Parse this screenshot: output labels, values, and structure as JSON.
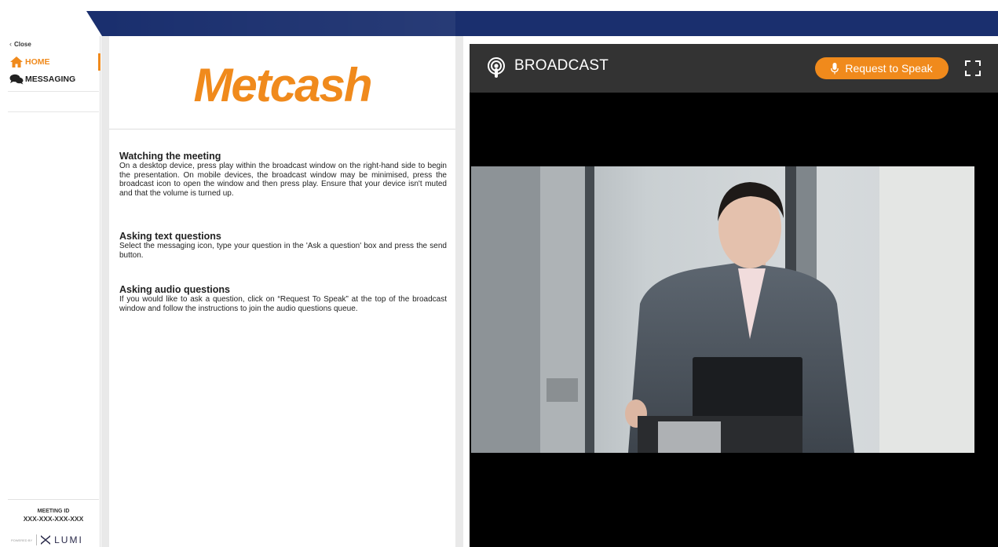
{
  "sidebar": {
    "close_label": "Close",
    "items": [
      {
        "label": "HOME",
        "icon": "home-icon",
        "active": true
      },
      {
        "label": "MESSAGING",
        "icon": "chat-bubbles-icon",
        "active": false
      }
    ],
    "meeting_id_label": "MEETING ID",
    "meeting_id_value": "XXX-XXX-XXX-XXX",
    "powered_by": "POWERED BY",
    "lumi": "LUMI"
  },
  "logo": {
    "text": "Metcash"
  },
  "sections": [
    {
      "heading": "Watching the meeting",
      "body": "On a desktop device, press play within the broadcast window on the right-hand side to begin the presentation. On mobile devices, the broadcast window may be minimised, press the broadcast icon to open the window and then press play. Ensure that your device isn't muted and that the volume is turned up."
    },
    {
      "heading": "Asking text questions",
      "body": "Select the messaging icon, type your question in the 'Ask a question' box and press the send button."
    },
    {
      "heading": "Asking audio questions",
      "body": "If you would like to ask a question, click on “Request To Speak” at the top of the broadcast window and follow the instructions to join the audio questions queue."
    }
  ],
  "broadcast": {
    "title": "BROADCAST",
    "request_label": "Request to Speak",
    "icons": [
      "podcast-icon",
      "microphone-icon",
      "fullscreen-icon"
    ]
  },
  "colors": {
    "accent": "#f08a1c",
    "banner": "#1a2f6e",
    "broadcast_header": "#333333"
  }
}
